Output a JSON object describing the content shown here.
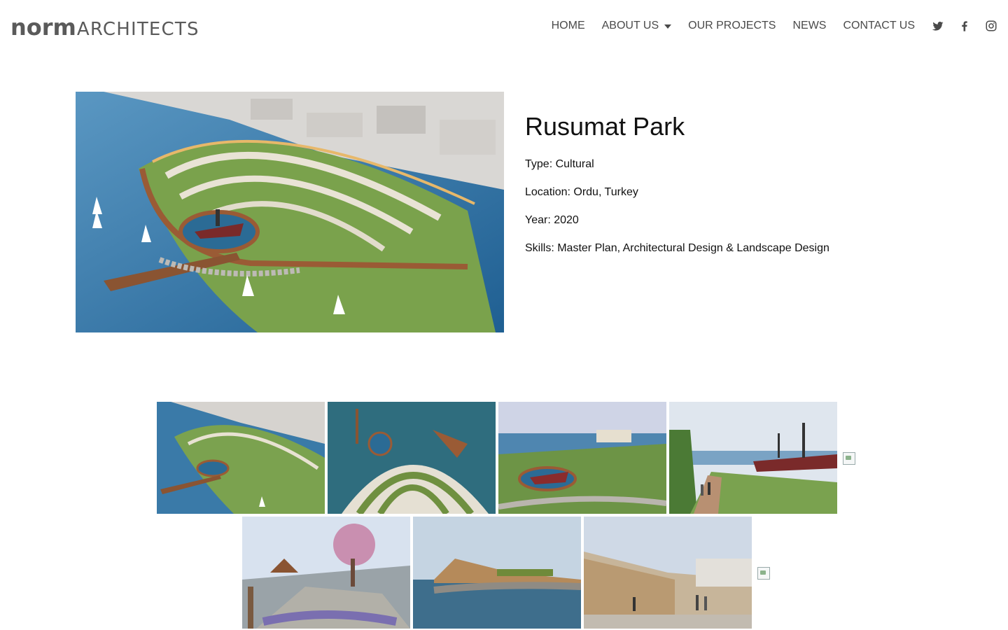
{
  "logo": {
    "bold": "norm",
    "thin": "ARCHITECTS"
  },
  "nav": {
    "items": [
      {
        "label": "HOME"
      },
      {
        "label": "ABOUT US"
      },
      {
        "label": "OUR PROJECTS"
      },
      {
        "label": "NEWS"
      },
      {
        "label": "CONTACT US"
      }
    ],
    "social": [
      "twitter-icon",
      "facebook-icon",
      "instagram-icon"
    ]
  },
  "project": {
    "title": "Rusumat Park",
    "type": "Type: Cultural",
    "location": "Location: Ordu, Turkey",
    "year": "Year: 2020",
    "skills": "Skills: Master Plan, Architectural Design & Landscape Design"
  },
  "colors": {
    "sea": "#2f6f9e",
    "vegetation": "#6f9a45",
    "deck": "#9a5b35",
    "building": "#d9d7d4",
    "text": "#111111",
    "nav": "#4a4a4a"
  }
}
